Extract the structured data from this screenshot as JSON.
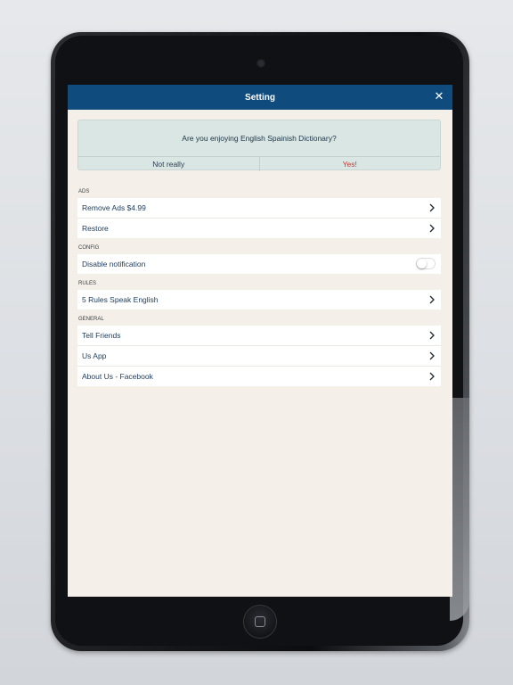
{
  "navbar": {
    "title": "Setting",
    "close_icon": "close-icon"
  },
  "rating": {
    "question": "Are you enjoying English Spainish Dictionary?",
    "no_label": "Not really",
    "yes_label": "Yes!"
  },
  "sections": {
    "ads": {
      "header": "ADS",
      "items": [
        {
          "label": "Remove Ads $4.99"
        },
        {
          "label": "Restore"
        }
      ]
    },
    "config": {
      "header": "CONFIG",
      "items": [
        {
          "label": "Disable notification",
          "toggle": false
        }
      ]
    },
    "rules": {
      "header": "RULES",
      "items": [
        {
          "label": "5 Rules Speak English"
        }
      ]
    },
    "general": {
      "header": "GENERAL",
      "items": [
        {
          "label": "Tell Friends"
        },
        {
          "label": "Us App"
        },
        {
          "label": "About Us - Facebook"
        }
      ]
    }
  },
  "colors": {
    "navbar": "#0f4b7c",
    "background": "#f4efe8",
    "rating_card": "#d9e6e3",
    "yes_accent": "#d0342c",
    "row_text": "#1b3a5a"
  }
}
